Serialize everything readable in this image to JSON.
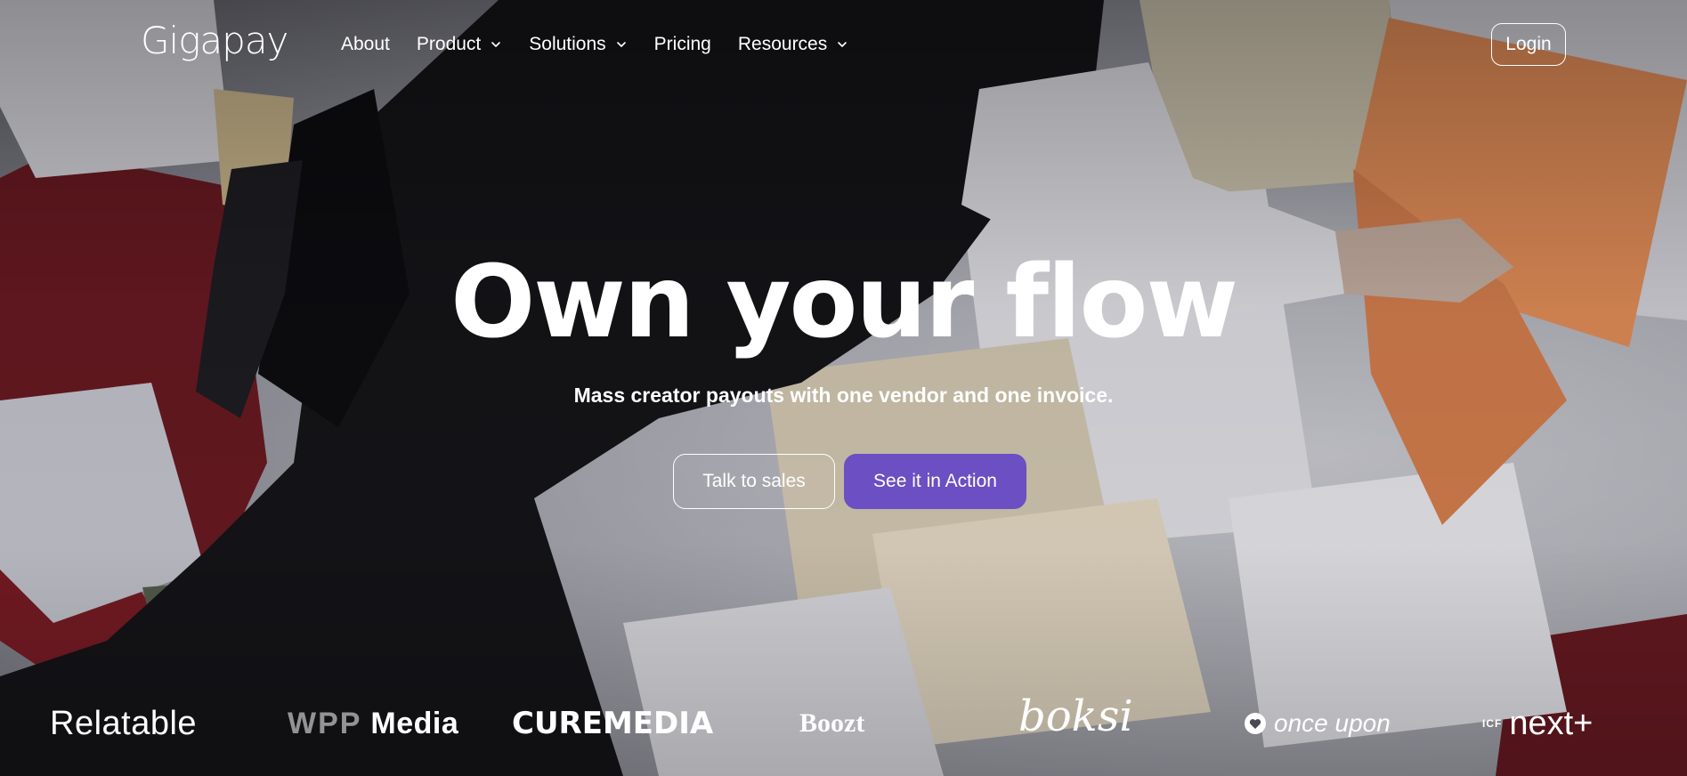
{
  "header": {
    "logo_text": "Gigapay",
    "nav": [
      {
        "label": "About",
        "has_dropdown": false
      },
      {
        "label": "Product",
        "has_dropdown": true
      },
      {
        "label": "Solutions",
        "has_dropdown": true
      },
      {
        "label": "Pricing",
        "has_dropdown": false
      },
      {
        "label": "Resources",
        "has_dropdown": true
      }
    ],
    "login_label": "Login"
  },
  "hero": {
    "title": "Own your flow",
    "subtitle": "Mass creator payouts with one vendor and one invoice.",
    "cta_secondary": "Talk to sales",
    "cta_primary": "See it in Action"
  },
  "logos": {
    "relatable": "Relatable",
    "wpp_prefix": "WPP",
    "wpp_suffix": "Media",
    "curemedia": "CUREMEDIA",
    "boozt": "Boozt",
    "boksi": "boksi",
    "onceupon": "once upon",
    "icf_prefix": "ICF",
    "icf_suffix": "next"
  },
  "colors": {
    "primary_button": "#6b4fc3",
    "text": "#ffffff"
  },
  "icons": {
    "dropdown": "chevron-down-icon",
    "onceupon_mark": "heart-icon"
  }
}
